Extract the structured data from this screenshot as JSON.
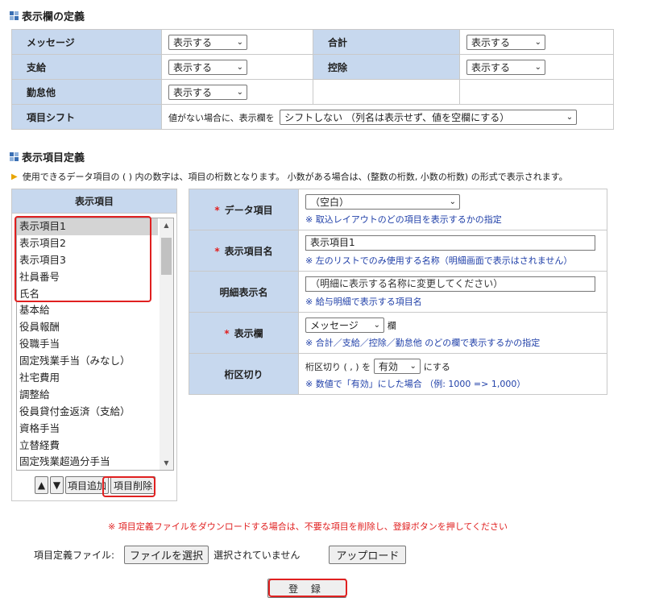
{
  "section1": {
    "title": "表示欄の定義"
  },
  "display": {
    "message_label": "メッセージ",
    "message_value": "表示する",
    "total_label": "合計",
    "total_value": "表示する",
    "pay_label": "支給",
    "pay_value": "表示する",
    "deduct_label": "控除",
    "deduct_value": "表示する",
    "attend_label": "勤怠他",
    "attend_value": "表示する",
    "shift_label": "項目シフト",
    "shift_prefix": "値がない場合に、表示欄を",
    "shift_value": "シフトしない （列名は表示せず、値を空欄にする）"
  },
  "section2": {
    "title": "表示項目定義"
  },
  "note": "使用できるデータ項目の ( ) 内の数字は、項目の桁数となります。 小数がある場合は、(整数の桁数, 小数の桁数) の形式で表示されます。",
  "list": {
    "header": "表示項目",
    "items": [
      "表示項目1",
      "表示項目2",
      "表示項目3",
      "社員番号",
      "氏名",
      "基本給",
      "役員報酬",
      "役職手当",
      "固定残業手当（みなし）",
      "社宅費用",
      "調整給",
      "役員貸付金返済（支給）",
      "資格手当",
      "立替経費",
      "固定残業超過分手当"
    ],
    "up_label": "▲",
    "down_label": "▼",
    "add_label": "項目追加",
    "delete_label": "項目削除"
  },
  "form": {
    "data_item_label": "データ項目",
    "data_item_value": "（空白）",
    "data_item_hint": "※ 取込レイアウトのどの項目を表示するかの指定",
    "name_label": "表示項目名",
    "name_value": "表示項目1",
    "name_hint": "※ 左のリストでのみ使用する名称（明細画面で表示はされません）",
    "detail_label": "明細表示名",
    "detail_placeholder": "（明細に表示する名称に変更してください）",
    "detail_hint": "※ 給与明細で表示する項目名",
    "column_label": "表示欄",
    "column_value": "メッセージ",
    "column_suffix": "欄",
    "column_hint": "※ 合計／支給／控除／勤怠他 のどの欄で表示するかの指定",
    "sep_label": "桁区切り",
    "sep_prefix": "桁区切り ( , ) を",
    "sep_value": "有効",
    "sep_suffix": "にする",
    "sep_hint": "※ 数値で「有効」にした場合 （例: 1000 => 1,000）"
  },
  "warning": "※ 項目定義ファイルをダウンロードする場合は、不要な項目を削除し、登録ボタンを押してください",
  "file": {
    "label": "項目定義ファイル:",
    "choose_label": "ファイルを選択",
    "status": "選択されていません",
    "upload_label": "アップロード"
  },
  "submit_label": "登 録"
}
